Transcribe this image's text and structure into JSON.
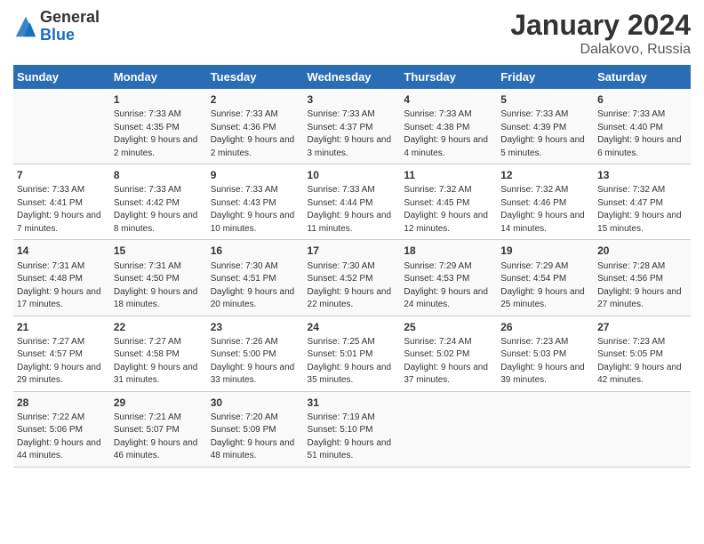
{
  "logo": {
    "general": "General",
    "blue": "Blue"
  },
  "title": "January 2024",
  "location": "Dalakovo, Russia",
  "weekdays": [
    "Sunday",
    "Monday",
    "Tuesday",
    "Wednesday",
    "Thursday",
    "Friday",
    "Saturday"
  ],
  "weeks": [
    [
      {
        "day": "",
        "sunrise": "",
        "sunset": "",
        "daylight": ""
      },
      {
        "day": "1",
        "sunrise": "Sunrise: 7:33 AM",
        "sunset": "Sunset: 4:35 PM",
        "daylight": "Daylight: 9 hours and 2 minutes."
      },
      {
        "day": "2",
        "sunrise": "Sunrise: 7:33 AM",
        "sunset": "Sunset: 4:36 PM",
        "daylight": "Daylight: 9 hours and 2 minutes."
      },
      {
        "day": "3",
        "sunrise": "Sunrise: 7:33 AM",
        "sunset": "Sunset: 4:37 PM",
        "daylight": "Daylight: 9 hours and 3 minutes."
      },
      {
        "day": "4",
        "sunrise": "Sunrise: 7:33 AM",
        "sunset": "Sunset: 4:38 PM",
        "daylight": "Daylight: 9 hours and 4 minutes."
      },
      {
        "day": "5",
        "sunrise": "Sunrise: 7:33 AM",
        "sunset": "Sunset: 4:39 PM",
        "daylight": "Daylight: 9 hours and 5 minutes."
      },
      {
        "day": "6",
        "sunrise": "Sunrise: 7:33 AM",
        "sunset": "Sunset: 4:40 PM",
        "daylight": "Daylight: 9 hours and 6 minutes."
      }
    ],
    [
      {
        "day": "7",
        "sunrise": "Sunrise: 7:33 AM",
        "sunset": "Sunset: 4:41 PM",
        "daylight": "Daylight: 9 hours and 7 minutes."
      },
      {
        "day": "8",
        "sunrise": "Sunrise: 7:33 AM",
        "sunset": "Sunset: 4:42 PM",
        "daylight": "Daylight: 9 hours and 8 minutes."
      },
      {
        "day": "9",
        "sunrise": "Sunrise: 7:33 AM",
        "sunset": "Sunset: 4:43 PM",
        "daylight": "Daylight: 9 hours and 10 minutes."
      },
      {
        "day": "10",
        "sunrise": "Sunrise: 7:33 AM",
        "sunset": "Sunset: 4:44 PM",
        "daylight": "Daylight: 9 hours and 11 minutes."
      },
      {
        "day": "11",
        "sunrise": "Sunrise: 7:32 AM",
        "sunset": "Sunset: 4:45 PM",
        "daylight": "Daylight: 9 hours and 12 minutes."
      },
      {
        "day": "12",
        "sunrise": "Sunrise: 7:32 AM",
        "sunset": "Sunset: 4:46 PM",
        "daylight": "Daylight: 9 hours and 14 minutes."
      },
      {
        "day": "13",
        "sunrise": "Sunrise: 7:32 AM",
        "sunset": "Sunset: 4:47 PM",
        "daylight": "Daylight: 9 hours and 15 minutes."
      }
    ],
    [
      {
        "day": "14",
        "sunrise": "Sunrise: 7:31 AM",
        "sunset": "Sunset: 4:48 PM",
        "daylight": "Daylight: 9 hours and 17 minutes."
      },
      {
        "day": "15",
        "sunrise": "Sunrise: 7:31 AM",
        "sunset": "Sunset: 4:50 PM",
        "daylight": "Daylight: 9 hours and 18 minutes."
      },
      {
        "day": "16",
        "sunrise": "Sunrise: 7:30 AM",
        "sunset": "Sunset: 4:51 PM",
        "daylight": "Daylight: 9 hours and 20 minutes."
      },
      {
        "day": "17",
        "sunrise": "Sunrise: 7:30 AM",
        "sunset": "Sunset: 4:52 PM",
        "daylight": "Daylight: 9 hours and 22 minutes."
      },
      {
        "day": "18",
        "sunrise": "Sunrise: 7:29 AM",
        "sunset": "Sunset: 4:53 PM",
        "daylight": "Daylight: 9 hours and 24 minutes."
      },
      {
        "day": "19",
        "sunrise": "Sunrise: 7:29 AM",
        "sunset": "Sunset: 4:54 PM",
        "daylight": "Daylight: 9 hours and 25 minutes."
      },
      {
        "day": "20",
        "sunrise": "Sunrise: 7:28 AM",
        "sunset": "Sunset: 4:56 PM",
        "daylight": "Daylight: 9 hours and 27 minutes."
      }
    ],
    [
      {
        "day": "21",
        "sunrise": "Sunrise: 7:27 AM",
        "sunset": "Sunset: 4:57 PM",
        "daylight": "Daylight: 9 hours and 29 minutes."
      },
      {
        "day": "22",
        "sunrise": "Sunrise: 7:27 AM",
        "sunset": "Sunset: 4:58 PM",
        "daylight": "Daylight: 9 hours and 31 minutes."
      },
      {
        "day": "23",
        "sunrise": "Sunrise: 7:26 AM",
        "sunset": "Sunset: 5:00 PM",
        "daylight": "Daylight: 9 hours and 33 minutes."
      },
      {
        "day": "24",
        "sunrise": "Sunrise: 7:25 AM",
        "sunset": "Sunset: 5:01 PM",
        "daylight": "Daylight: 9 hours and 35 minutes."
      },
      {
        "day": "25",
        "sunrise": "Sunrise: 7:24 AM",
        "sunset": "Sunset: 5:02 PM",
        "daylight": "Daylight: 9 hours and 37 minutes."
      },
      {
        "day": "26",
        "sunrise": "Sunrise: 7:23 AM",
        "sunset": "Sunset: 5:03 PM",
        "daylight": "Daylight: 9 hours and 39 minutes."
      },
      {
        "day": "27",
        "sunrise": "Sunrise: 7:23 AM",
        "sunset": "Sunset: 5:05 PM",
        "daylight": "Daylight: 9 hours and 42 minutes."
      }
    ],
    [
      {
        "day": "28",
        "sunrise": "Sunrise: 7:22 AM",
        "sunset": "Sunset: 5:06 PM",
        "daylight": "Daylight: 9 hours and 44 minutes."
      },
      {
        "day": "29",
        "sunrise": "Sunrise: 7:21 AM",
        "sunset": "Sunset: 5:07 PM",
        "daylight": "Daylight: 9 hours and 46 minutes."
      },
      {
        "day": "30",
        "sunrise": "Sunrise: 7:20 AM",
        "sunset": "Sunset: 5:09 PM",
        "daylight": "Daylight: 9 hours and 48 minutes."
      },
      {
        "day": "31",
        "sunrise": "Sunrise: 7:19 AM",
        "sunset": "Sunset: 5:10 PM",
        "daylight": "Daylight: 9 hours and 51 minutes."
      },
      {
        "day": "",
        "sunrise": "",
        "sunset": "",
        "daylight": ""
      },
      {
        "day": "",
        "sunrise": "",
        "sunset": "",
        "daylight": ""
      },
      {
        "day": "",
        "sunrise": "",
        "sunset": "",
        "daylight": ""
      }
    ]
  ]
}
